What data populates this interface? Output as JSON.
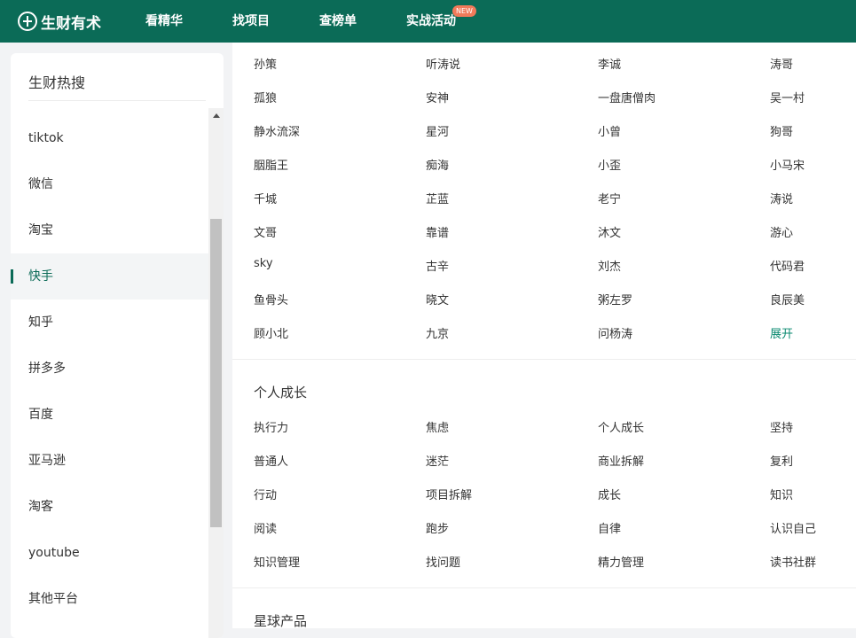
{
  "nav": {
    "logo_text": "生财有术",
    "items": [
      {
        "label": "看精华"
      },
      {
        "label": "找项目"
      },
      {
        "label": "查榜单"
      },
      {
        "label": "实战活动",
        "badge": "NEW"
      }
    ]
  },
  "sidebar": {
    "title": "生财热搜",
    "items": [
      {
        "label": "tiktok"
      },
      {
        "label": "微信"
      },
      {
        "label": "淘宝"
      },
      {
        "label": "快手",
        "active": true
      },
      {
        "label": "知乎"
      },
      {
        "label": "拼多多"
      },
      {
        "label": "百度"
      },
      {
        "label": "亚马逊"
      },
      {
        "label": "淘客"
      },
      {
        "label": "youtube"
      },
      {
        "label": "其他平台"
      }
    ]
  },
  "people": {
    "rows": [
      [
        "孙策",
        "听涛说",
        "李诚",
        "涛哥"
      ],
      [
        "孤狼",
        "安神",
        "一盘唐僧肉",
        "吴一村"
      ],
      [
        "静水流深",
        "星河",
        "小曾",
        "狗哥"
      ],
      [
        "胭脂王",
        "痴海",
        "小歪",
        "小马宋"
      ],
      [
        "千城",
        "芷蓝",
        "老宁",
        "涛说"
      ],
      [
        "文哥",
        "靠谱",
        "沐文",
        "游心"
      ],
      [
        "sky",
        "古辛",
        "刘杰",
        "代码君"
      ],
      [
        "鱼骨头",
        "晓文",
        "粥左罗",
        "良辰美"
      ],
      [
        "顾小北",
        "九京",
        "问杨涛",
        "展开"
      ]
    ]
  },
  "growth": {
    "title": "个人成长",
    "rows": [
      [
        "执行力",
        "焦虑",
        "个人成长",
        "坚持"
      ],
      [
        "普通人",
        "迷茫",
        "商业拆解",
        "复利"
      ],
      [
        "行动",
        "项目拆解",
        "成长",
        "知识"
      ],
      [
        "阅读",
        "跑步",
        "自律",
        "认识自己"
      ],
      [
        "知识管理",
        "找问题",
        "精力管理",
        "读书社群"
      ]
    ]
  },
  "products": {
    "title": "星球产品"
  },
  "colors": {
    "brand": "#0b6b57",
    "accent": "#0b8a70",
    "badge": "#f07a5a"
  }
}
